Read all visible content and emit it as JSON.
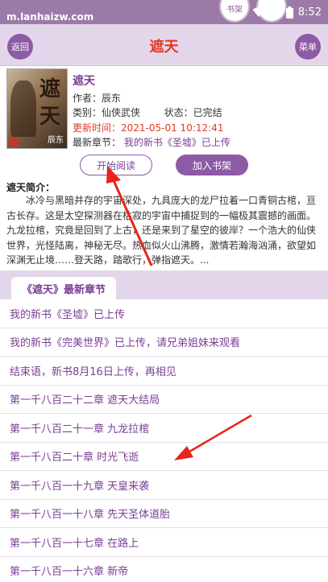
{
  "status_bar": {
    "url": "m.lanhaizw.com",
    "bubble_left": "书架",
    "time": "8:52"
  },
  "header": {
    "back_label": "返回",
    "title": "遮天",
    "menu_label": "菜单"
  },
  "book": {
    "cover_title_1": "遮",
    "cover_title_2": "天",
    "cover_author": "辰东",
    "name": "遮天",
    "author_line": "作者：辰东",
    "category_line": "类别：仙侠武侠",
    "status_line": "状态：已完结",
    "update_line": "更新时间：2021-05-01 10:12:41",
    "latest_prefix": "最新章节：",
    "latest_chapter": "我的新书《圣墟》已上传"
  },
  "actions": {
    "read_label": "开始阅读",
    "shelf_label": "加入书架"
  },
  "intro": {
    "title": "遮天简介：",
    "text": "冰冷与黑暗并存的宇宙深处，九具庞大的龙尸拉着一口青铜古棺，亘古长存。这是太空探测器在枯寂的宇宙中捕捉到的一幅极其震撼的画面。九龙拉棺，究竟是回到了上古，还是来到了星空的彼岸？一个浩大的仙侠世界，光怪陆离，神秘无尽。热血似火山沸腾，激情若瀚海汹涌，欲望如深渊无止境……登天路，踏歌行，弹指遮天。..."
  },
  "chapters": {
    "tab_label": "《遮天》最新章节",
    "items": [
      "我的新书《圣墟》已上传",
      "我的新书《完美世界》已上传，请兄弟姐妹来观看",
      "结束语，新书8月16日上传，再相见",
      "第一千八百二十二章 遮天大结局",
      "第一千八百二十一章 九龙拉棺",
      "第一千八百二十章 时光飞逝",
      "第一千八百一十九章 天皇来袭",
      "第一千八百一十八章 先天圣体道胎",
      "第一千八百一十七章 在路上",
      "第一千八百一十六章 新帝"
    ]
  },
  "colors": {
    "accent": "#8d5aa6",
    "title_red": "#e23a22",
    "link_purple": "#7a3f96",
    "band": "#e4d6ea",
    "annotation_red": "#e8241a"
  }
}
